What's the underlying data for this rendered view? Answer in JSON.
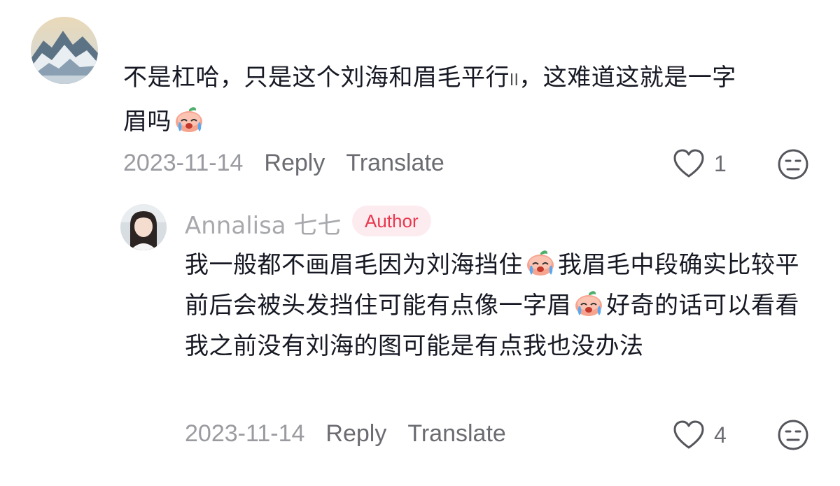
{
  "comment": {
    "text_line1": "不是杠哈，只是这个刘海和眉毛平行",
    "text_line1_b": "，这难道这就是一字",
    "text_line2": "眉吗",
    "date": "2023-11-14",
    "reply_label": "Reply",
    "translate_label": "Translate",
    "like_count": "1"
  },
  "reply": {
    "username": "Annalisa 七七",
    "badge": "Author",
    "text_seg1": "我一般都不画眉毛因为刘海挡住",
    "text_seg2": "我眉毛中段确实比较平 前后会被头发挡住可能有点像一字眉",
    "text_seg3": "好奇的话可以看看我之前没有刘海的图可能是有点我也没办法",
    "date": "2023-11-14",
    "reply_label": "Reply",
    "translate_label": "Translate",
    "like_count": "4"
  },
  "icons": {
    "like": "heart-outline-icon",
    "dislike": "neutral-face-icon",
    "emoji": "crying-peach-emoji"
  },
  "colors": {
    "author_badge_bg": "#fdecef",
    "author_badge_text": "#e8384f",
    "meta_gray": "#9a9ba0"
  }
}
